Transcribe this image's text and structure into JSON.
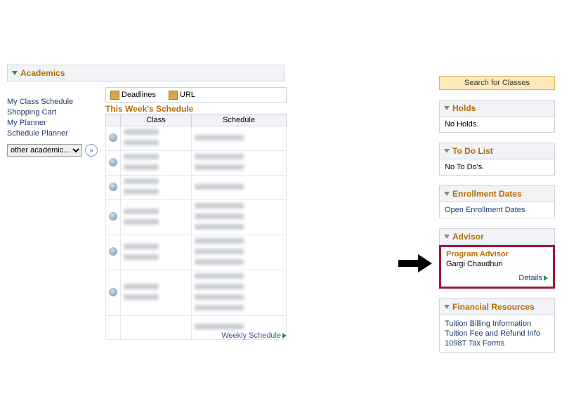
{
  "academics": {
    "title": "Academics",
    "links": {
      "my_class_schedule": "My Class Schedule",
      "shopping_cart": "Shopping Cart",
      "my_planner": "My Planner",
      "schedule_planner": "Schedule Planner"
    },
    "other_select": "other academic...",
    "go_label": "»"
  },
  "toolbar": {
    "deadlines": "Deadlines",
    "url": "URL"
  },
  "schedule": {
    "title": "This Week's Schedule",
    "col_class": "Class",
    "col_schedule": "Schedule",
    "weekly_link": "Weekly Schedule"
  },
  "right": {
    "search": "Search for Classes",
    "holds": {
      "title": "Holds",
      "body": "No Holds."
    },
    "todo": {
      "title": "To Do List",
      "body": "No To Do's."
    },
    "enroll": {
      "title": "Enrollment Dates",
      "link": "Open Enrollment Dates"
    },
    "advisor": {
      "title": "Advisor",
      "label": "Program Advisor",
      "name": "Gargi Chaudhuri",
      "details": "Details"
    },
    "fin": {
      "title": "Financial Resources",
      "links": {
        "billing": "Tuition Billing Information",
        "refund": "Tuition Fee and Refund Info",
        "tax": "1098T Tax Forms"
      }
    }
  }
}
